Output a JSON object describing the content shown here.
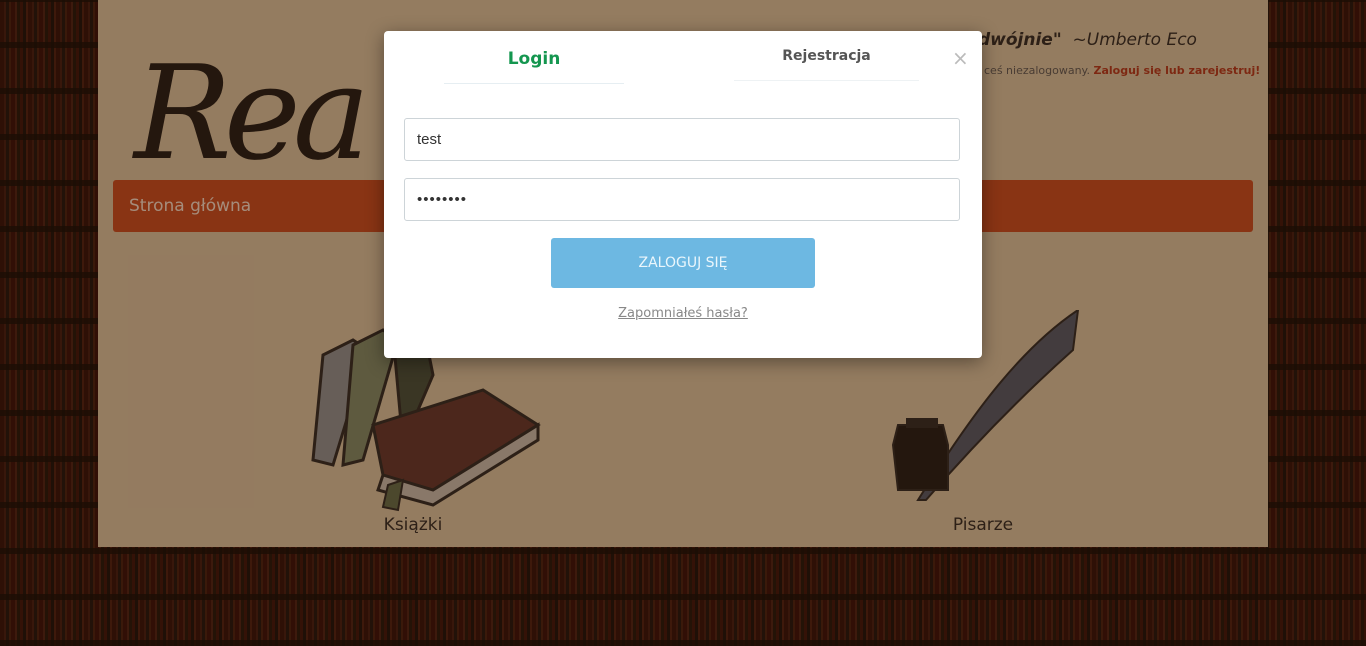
{
  "background_page": {
    "logo_text": "Rea",
    "quote": {
      "text": "dwójnie\"",
      "author": "~Umberto Eco"
    },
    "login_note": {
      "text": "ceś niezalogowany.",
      "link": "Zaloguj się lub zarejestruj!"
    },
    "nav": {
      "home": "Strona główna"
    },
    "tiles": [
      {
        "label": "Książki",
        "icon": "books-icon"
      },
      {
        "label": "Pisarze",
        "icon": "quill-icon"
      }
    ]
  },
  "modal": {
    "tabs": {
      "login": "Login",
      "register": "Rejestracja"
    },
    "close_symbol": "×",
    "username_value": "test",
    "password_value": "••••••••",
    "submit_label": "ZALOGUJ SIĘ",
    "forgot_label": "Zapomniałeś hasła?"
  },
  "colors": {
    "login_tab": "#14964f",
    "submit_button": "#6db8e2",
    "nav_bar": "#c8461c"
  }
}
